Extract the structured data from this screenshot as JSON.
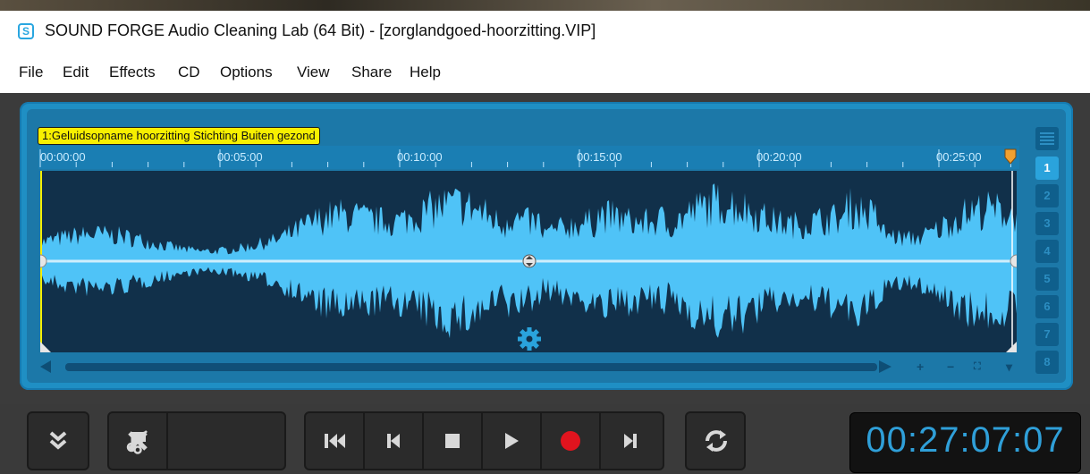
{
  "window": {
    "title": "SOUND FORGE Audio Cleaning Lab (64 Bit) - [zorglandgoed-hoorzitting.VIP]",
    "app_icon_letter": "S"
  },
  "menu": [
    "File",
    "Edit",
    "Effects",
    "CD",
    "Options",
    "View",
    "Share",
    "Help"
  ],
  "clip": {
    "label": "1:Geluidsopname hoorzitting Stichting Buiten gezond"
  },
  "ruler": {
    "labels": [
      "00:00:00",
      "00:05:00",
      "00:10:00",
      "00:15:00",
      "00:20:00",
      "00:25:00"
    ]
  },
  "scrollbar": {
    "zoom_in": "+",
    "zoom_out": "−",
    "fit": "⛶",
    "menu": "▾"
  },
  "tracks": [
    "1",
    "2",
    "3",
    "4",
    "5",
    "6",
    "7",
    "8"
  ],
  "active_track": "1",
  "transport": {
    "time": "00:27:07:07"
  },
  "colors": {
    "accent": "#2aa3dc",
    "waveform": "#4fc3f7",
    "wave_background": "#11304a",
    "clip_label": "#f7ef00",
    "record": "#e0141e",
    "time_text": "#2f9fd8"
  },
  "icons": {
    "app": "sound-forge-icon",
    "collapse": "double-chevron-down-icon",
    "cut": "scissors-icon",
    "delete": "x-icon",
    "marker": "flag-icon",
    "rewind": "skip-to-start-icon",
    "previous": "previous-icon",
    "stop": "stop-icon",
    "play": "play-icon",
    "record": "record-icon",
    "next": "next-icon",
    "loop": "loop-icon",
    "settings": "gear-icon"
  }
}
